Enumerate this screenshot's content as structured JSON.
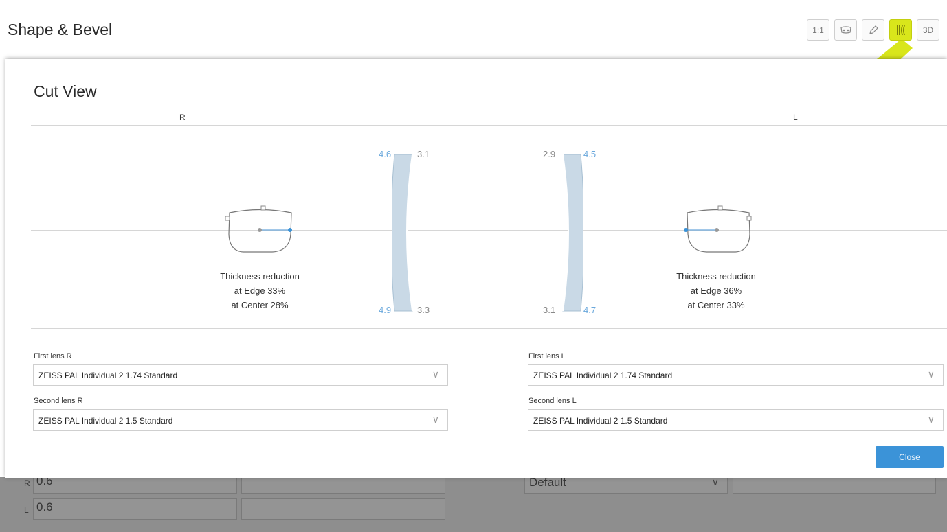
{
  "page": {
    "title": "Shape & Bevel",
    "view_buttons": [
      {
        "label": "1:1",
        "icon": "one-to-one-icon"
      },
      {
        "label": "",
        "icon": "frame-shape-icon"
      },
      {
        "label": "",
        "icon": "pencil-icon"
      },
      {
        "label": "",
        "icon": "cut-view-icon",
        "active": true
      },
      {
        "label": "3D",
        "icon": "3d-icon"
      }
    ],
    "accent_color": "#d9e61b"
  },
  "background_form": {
    "row_r": {
      "side": "R",
      "value": "0.6"
    },
    "row_l": {
      "side": "L",
      "value": "0.6"
    },
    "select_value": "Default"
  },
  "modal": {
    "title": "Cut View",
    "right_label": "R",
    "left_label": "L",
    "right_lens": {
      "thickness_line1": "Thickness reduction",
      "thickness_line2": "at Edge 33%",
      "thickness_line3": "at Center 28%",
      "top_outer": "4.6",
      "top_inner": "3.1",
      "bottom_outer": "4.9",
      "bottom_inner": "3.3"
    },
    "left_lens": {
      "thickness_line1": "Thickness reduction",
      "thickness_line2": "at Edge 36%",
      "thickness_line3": "at Center 33%",
      "top_inner": "2.9",
      "top_outer": "4.5",
      "bottom_inner": "3.1",
      "bottom_outer": "4.7"
    },
    "first_lens_r": {
      "label": "First lens R",
      "value": "ZEISS PAL Individual 2 1.74 Standard"
    },
    "second_lens_r": {
      "label": "Second lens R",
      "value": "ZEISS PAL Individual 2 1.5 Standard"
    },
    "first_lens_l": {
      "label": "First lens L",
      "value": "ZEISS PAL Individual 2 1.74 Standard"
    },
    "second_lens_l": {
      "label": "Second lens L",
      "value": "ZEISS PAL Individual 2 1.5 Standard"
    },
    "close_label": "Close",
    "close_color": "#3b93d8"
  }
}
